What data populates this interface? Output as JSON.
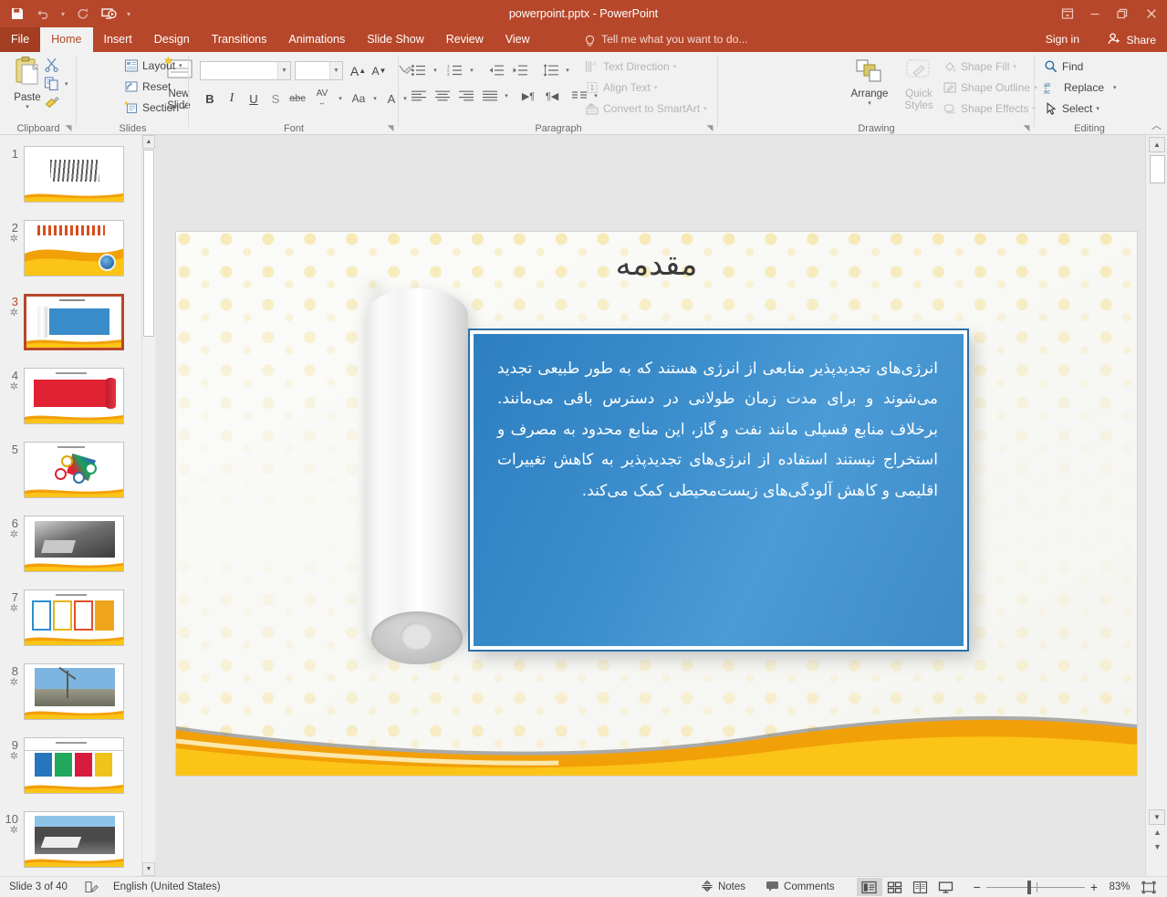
{
  "titlebar": {
    "document_title": "powerpoint.pptx - PowerPoint",
    "qat": [
      {
        "name": "save-icon",
        "label": "Save"
      },
      {
        "name": "undo-icon",
        "label": "Undo"
      },
      {
        "name": "redo-icon",
        "label": "Redo"
      },
      {
        "name": "start-from-beginning-icon",
        "label": "Start From Beginning"
      },
      {
        "name": "customize-quick-access-toolbar-icon",
        "label": "Customize Quick Access Toolbar"
      }
    ],
    "window_controls": [
      {
        "name": "ribbon-display-options-icon",
        "label": "Ribbon Display Options"
      },
      {
        "name": "minimize-icon",
        "label": "Minimize"
      },
      {
        "name": "restore-icon",
        "label": "Restore Down"
      },
      {
        "name": "close-icon",
        "label": "Close"
      }
    ]
  },
  "tabs": [
    {
      "label": "File",
      "active": false,
      "file": true
    },
    {
      "label": "Home",
      "active": true,
      "file": false
    },
    {
      "label": "Insert",
      "active": false,
      "file": false
    },
    {
      "label": "Design",
      "active": false,
      "file": false
    },
    {
      "label": "Transitions",
      "active": false,
      "file": false
    },
    {
      "label": "Animations",
      "active": false,
      "file": false
    },
    {
      "label": "Slide Show",
      "active": false,
      "file": false
    },
    {
      "label": "Review",
      "active": false,
      "file": false
    },
    {
      "label": "View",
      "active": false,
      "file": false
    }
  ],
  "tellme": {
    "placeholder": "Tell me what you want to do..."
  },
  "account": {
    "signin_label": "Sign in",
    "share_label": "Share"
  },
  "ribbon": {
    "groups": [
      {
        "name": "clipboard",
        "label": "Clipboard"
      },
      {
        "name": "slides",
        "label": "Slides"
      },
      {
        "name": "font",
        "label": "Font"
      },
      {
        "name": "paragraph",
        "label": "Paragraph"
      },
      {
        "name": "drawing",
        "label": "Drawing"
      },
      {
        "name": "editing",
        "label": "Editing"
      }
    ],
    "clipboard": {
      "paste_label": "Paste",
      "cut_label": "Cut",
      "copy_label": "Copy",
      "format_painter_label": "Format Painter"
    },
    "slides": {
      "new_slide_label": "New Slide",
      "layout_label": "Layout",
      "reset_label": "Reset",
      "section_label": "Section"
    },
    "font": {
      "font_name_value": "",
      "font_size_value": "",
      "increase_font_label": "A",
      "decrease_font_label": "A",
      "clear_formatting_label": "Clear All Formatting",
      "bold_label": "B",
      "italic_label": "I",
      "underline_label": "U",
      "shadow_label": "S",
      "strikethrough_label": "abc",
      "character_spacing_label": "AV",
      "change_case_label": "Aa",
      "font_color_label": "A"
    },
    "paragraph": {
      "text_direction_label": "Text Direction",
      "align_text_label": "Align Text",
      "convert_to_smartart_label": "Convert to SmartArt"
    },
    "drawing": {
      "arrange_label": "Arrange",
      "quick_styles_label": "Quick Styles",
      "shape_fill_label": "Shape Fill",
      "shape_outline_label": "Shape Outline",
      "shape_effects_label": "Shape Effects"
    },
    "editing": {
      "find_label": "Find",
      "replace_label": "Replace",
      "select_label": "Select"
    }
  },
  "thumbnails": [
    {
      "number": "1",
      "animated": false,
      "active": false
    },
    {
      "number": "2",
      "animated": true,
      "active": false
    },
    {
      "number": "3",
      "animated": true,
      "active": true
    },
    {
      "number": "4",
      "animated": true,
      "active": false
    },
    {
      "number": "5",
      "animated": false,
      "active": false
    },
    {
      "number": "6",
      "animated": true,
      "active": false
    },
    {
      "number": "7",
      "animated": true,
      "active": false
    },
    {
      "number": "8",
      "animated": true,
      "active": false
    },
    {
      "number": "9",
      "animated": true,
      "active": false
    },
    {
      "number": "10",
      "animated": true,
      "active": false
    }
  ],
  "slide": {
    "title": "مقدمه",
    "body": "انرژی‌های تجدیدپذیر منابعی از انرژی هستند که به طور طبیعی تجدید می‌شوند و برای مدت زمان طولانی در دسترس باقی می‌مانند. برخلاف منابع فسیلی مانند نفت و گاز، این منابع محدود به مصرف و استخراج نیستند استفاده از انرژی‌های تجدیدپذیر به کاهش تغییرات اقلیمی و کاهش آلودگی‌های زیست‌محیطی کمک می‌کند.",
    "colors": {
      "panel_blue": "#3a8ccb",
      "panel_border": "#ffffff",
      "accent_orange": "#f2a007",
      "accent_yellow": "#fbc417",
      "background": "#fafaf8"
    }
  },
  "statusbar": {
    "slide_counter": "Slide 3 of 40",
    "language": "English (United States)",
    "notes_label": "Notes",
    "comments_label": "Comments",
    "zoom_level": "83%",
    "views": [
      {
        "name": "normal-view-button",
        "active": true
      },
      {
        "name": "slide-sorter-view-button",
        "active": false
      },
      {
        "name": "reading-view-button",
        "active": false
      },
      {
        "name": "slide-show-button",
        "active": false
      }
    ],
    "zoom_out_label": "−",
    "zoom_in_label": "+",
    "fit_slide_label": "Fit slide to current window"
  }
}
